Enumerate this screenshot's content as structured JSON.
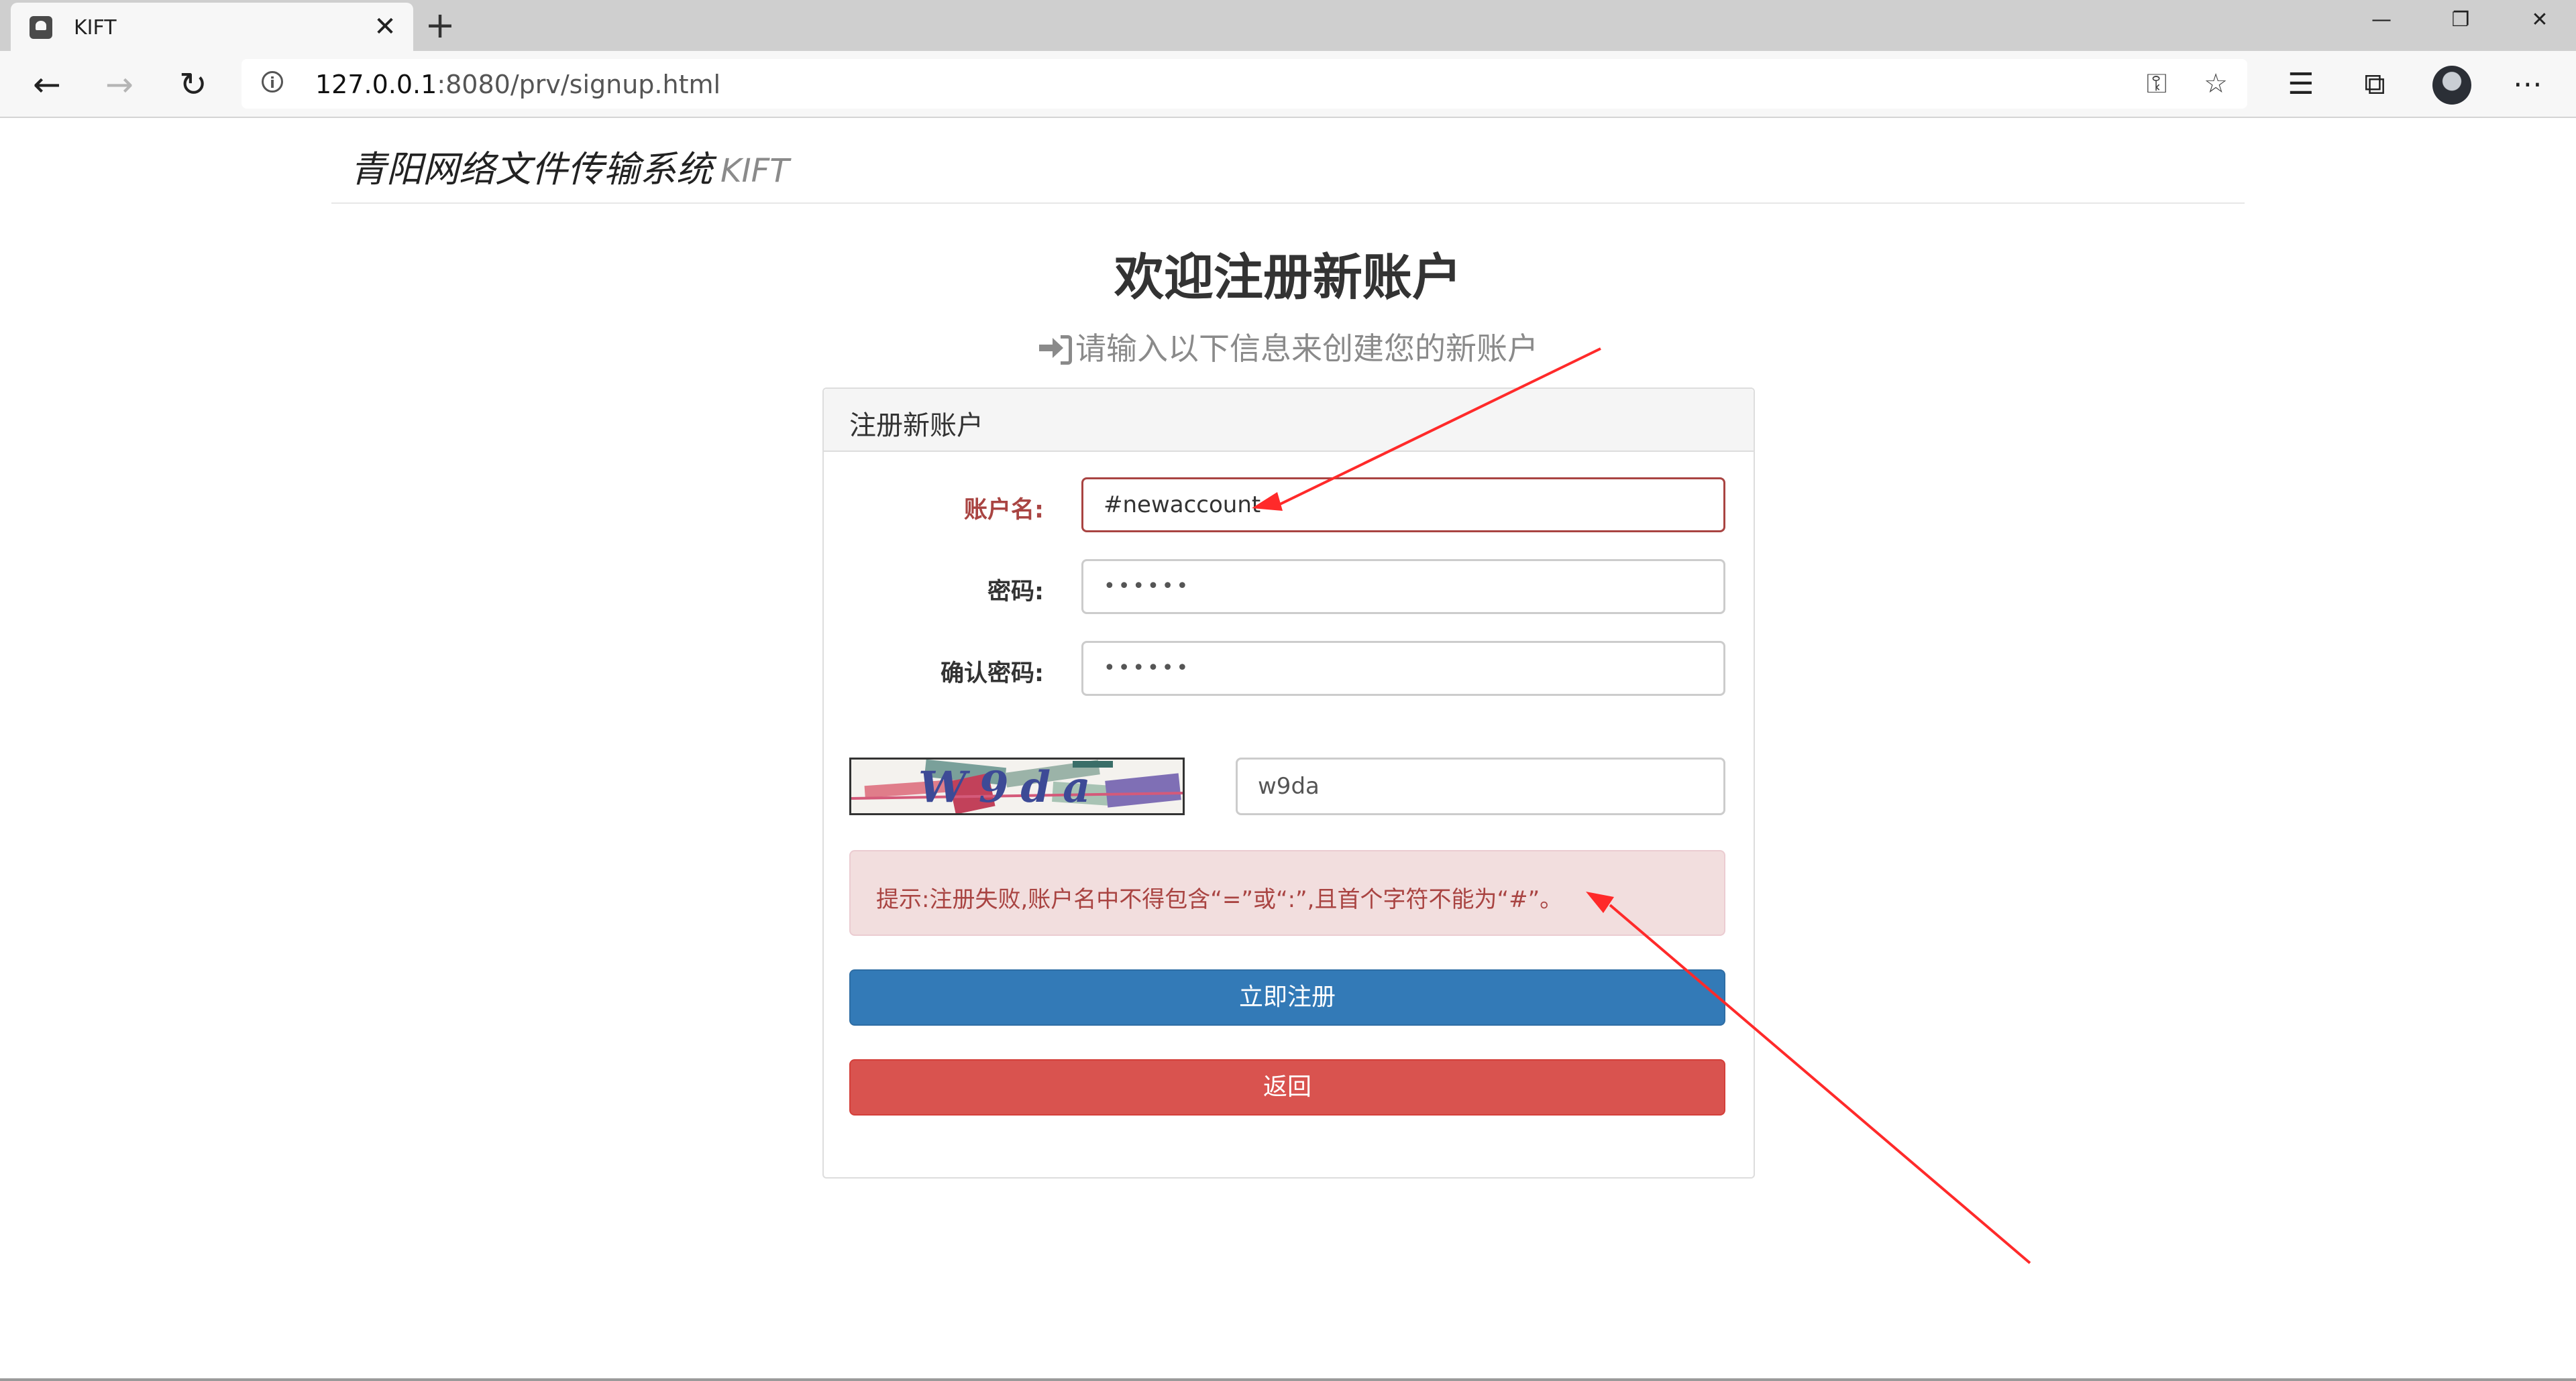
{
  "browser": {
    "tab_title": "KIFT",
    "tab_close": "✕",
    "new_tab": "+",
    "url_host": "127.0.0.1",
    "url_path": ":8080/prv/signup.html",
    "window_controls": {
      "minimize": "—",
      "restore": "❐",
      "close": "✕"
    },
    "icons": {
      "back": "←",
      "forward": "→",
      "refresh": "↻",
      "key": "⚿",
      "favorite": "☆",
      "favorites_list": "☰",
      "collections": "⧉",
      "more": "⋯"
    }
  },
  "navbar": {
    "brand": "青阳网络文件传输系统",
    "brand_sub": "KIFT"
  },
  "heading": "欢迎注册新账户",
  "subheading": "请输入以下信息来创建您的新账户",
  "panel": {
    "title": "注册新账户",
    "fields": {
      "account": {
        "label": "账户名:",
        "value": "#newaccount"
      },
      "password": {
        "label": "密码:",
        "value": "••••••"
      },
      "confirm": {
        "label": "确认密码:",
        "value": "••••••"
      }
    },
    "captcha": {
      "image_text": "W9da",
      "input_value": "w9da"
    },
    "alert": "提示:注册失败,账户名中不得包含“=”或“:”,且首个字符不能为“#”。",
    "submit": "立即注册",
    "back": "返回"
  },
  "colors": {
    "primary": "#337ab7",
    "danger": "#d9534f",
    "error_text": "#a94442",
    "alert_bg": "#f2dede",
    "annotation_arrow": "#ff2a2a"
  }
}
